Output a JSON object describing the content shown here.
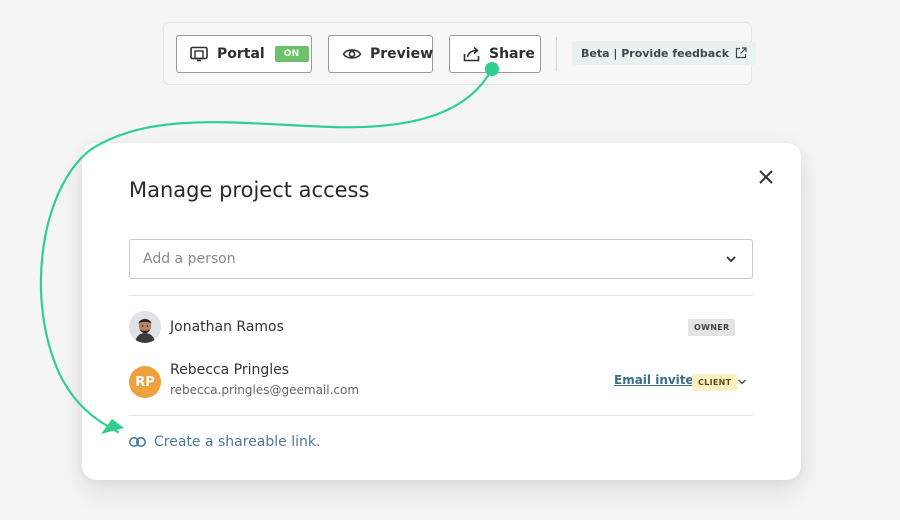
{
  "toolbar": {
    "portal_label": "Portal",
    "portal_status": "ON",
    "preview_label": "Preview",
    "share_label": "Share",
    "feedback_label": "Beta | Provide feedback"
  },
  "modal": {
    "title": "Manage project access",
    "add_person_placeholder": "Add a person",
    "people": [
      {
        "name": "Jonathan Ramos",
        "role": "OWNER"
      },
      {
        "name": "Rebecca Pringles",
        "initials": "RP",
        "email": "rebecca.pringles@geemail.com",
        "role": "CLIENT",
        "action": "Email invite"
      }
    ],
    "share_link_label": "Create a shareable link."
  },
  "colors": {
    "accent_green": "#2fcf92",
    "on_badge": "#6cc26b",
    "link_blue": "#3a6f8d",
    "avatar_orange": "#f0a13d",
    "client_badge_bg": "#fbefc4",
    "owner_badge_bg": "#e3e3e3"
  },
  "icons": {
    "portal": "portal-icon",
    "preview": "eye-icon",
    "share": "share-icon",
    "feedback": "external-link-icon",
    "close": "close-icon",
    "dropdown": "chevron-down-icon",
    "link": "link-icon"
  }
}
